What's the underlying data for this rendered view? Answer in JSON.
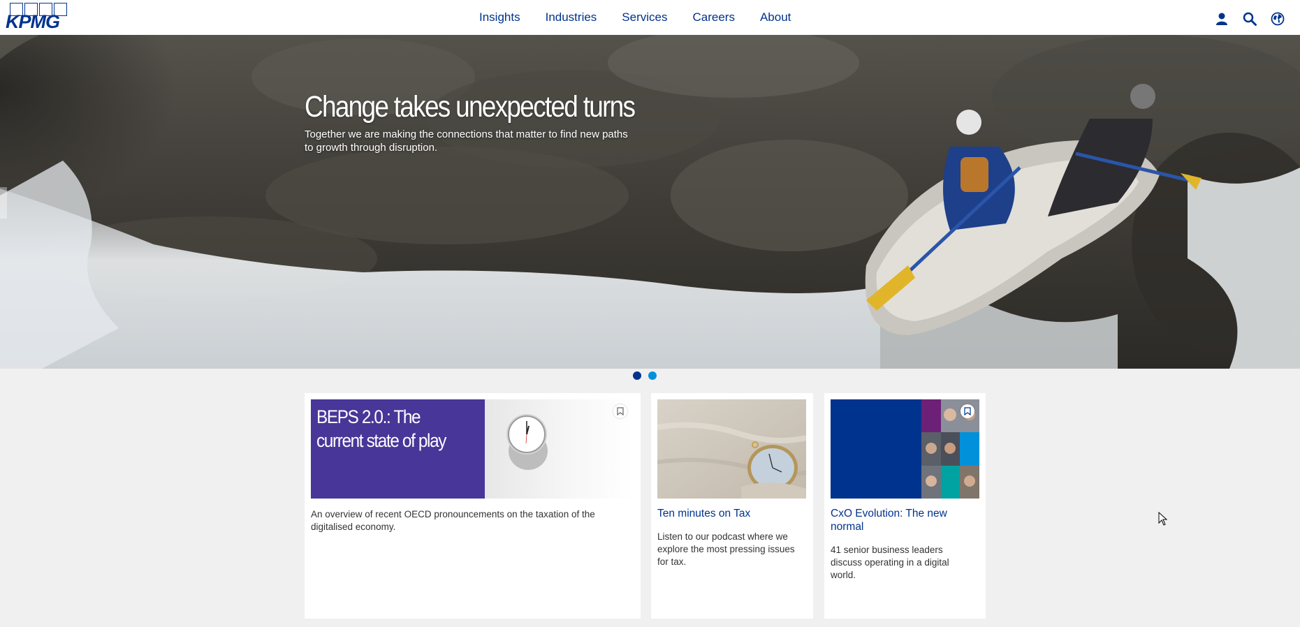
{
  "brand": {
    "logo_text": "KPMG",
    "primary_color": "#00338d",
    "accent_color": "#0091da",
    "purple": "#483698"
  },
  "nav": {
    "items": [
      "Insights",
      "Industries",
      "Services",
      "Careers",
      "About"
    ]
  },
  "tools": {
    "icons": [
      "user-icon",
      "search-icon",
      "globe-icon"
    ]
  },
  "hero": {
    "title": "Change takes unexpected turns",
    "subtitle": "Together we are making the connections that matter to find new paths to growth through disruption.",
    "slide_count": 2,
    "active_slide": 1
  },
  "cards": [
    {
      "image_title": "BEPS 2.0.: The current state of play",
      "description": "An overview of recent OECD pronouncements on the taxation of the digitalised economy.",
      "bookmark_icon": "bookmark-icon"
    },
    {
      "title": "Ten minutes on Tax",
      "description": "Listen to our podcast where we explore the most pressing issues for tax."
    },
    {
      "title": "CxO Evolution: The new normal",
      "description": "41 senior business leaders discuss operating in a digital world.",
      "bookmark_icon": "bookmark-icon"
    }
  ]
}
